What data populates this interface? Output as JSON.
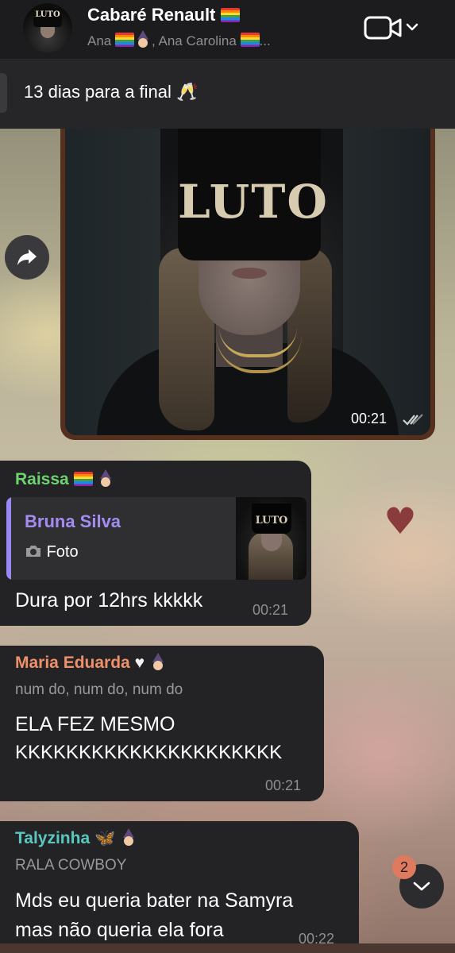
{
  "header": {
    "title": "Cabaré Renault",
    "subtitle": "Ana , Ana Carolina ...",
    "avatar_label": "LUTO",
    "video_icon": "video-camera-icon",
    "chevron_icon": "chevron-down-icon"
  },
  "pinned": {
    "text": "13 dias para a final 🥂"
  },
  "image_message": {
    "overlay_text": "LUTO",
    "time": "00:21",
    "status_icon": "double-check-icon"
  },
  "messages": [
    {
      "sender": "Raissa",
      "sender_color": "#6fd36f",
      "reply": {
        "name": "Bruna Silva",
        "type": "Foto",
        "thumb_label": "LUTO"
      },
      "text": "Dura por 12hrs kkkkk",
      "time": "00:21"
    },
    {
      "sender": "Maria Eduarda",
      "sender_color": "#f0906a",
      "subtext": "num do, num do, num do",
      "text_line1": "ELA FEZ MESMO",
      "text_line2": "KKKKKKKKKKKKKKKKKKKKK",
      "time": "00:21"
    },
    {
      "sender": "Talyzinha",
      "sender_color": "#59c9c0",
      "subtext": "RALA COWBOY",
      "text_line1": "Mds eu queria bater na Samyra",
      "text_line2": "mas não queria ela fora",
      "time": "00:22"
    }
  ],
  "scroll_down": {
    "unread_count": "2"
  },
  "colors": {
    "header_bg": "#1c1c1e",
    "bubble_bg": "#232325",
    "reply_accent": "#9b87f5",
    "badge": "#e07a5f"
  }
}
